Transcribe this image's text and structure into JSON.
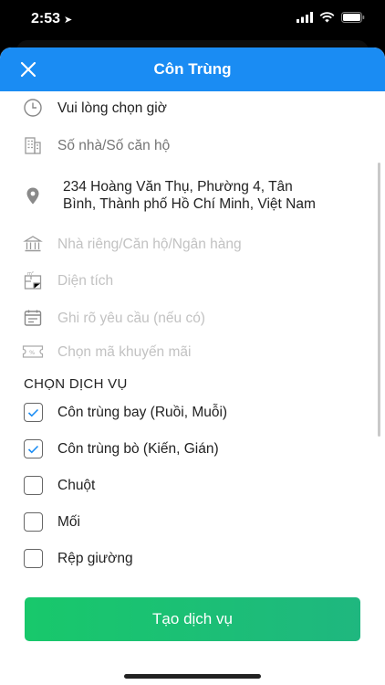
{
  "status_bar": {
    "time": "2:53",
    "location_icon": "location-arrow-icon",
    "wifi_icon": "wifi-icon",
    "battery_icon": "battery-icon"
  },
  "nav": {
    "title": "Côn Trùng",
    "close_icon": "close-icon"
  },
  "form": {
    "time_text": "Vui lòng chọn giờ",
    "house_number_placeholder": "Số nhà/Số căn hộ",
    "address_line1": "234 Hoàng Văn Thụ, Phường 4, Tân",
    "address_line2": "Bình, Thành phố Hồ Chí Minh, Việt Nam",
    "home_type_placeholder": "Nhà riêng/Căn hộ/Ngân hàng",
    "area_placeholder": "Diện tích",
    "note_placeholder": "Ghi rõ yêu cầu (nếu có)",
    "promo_placeholder": "Chọn mã khuyến mãi"
  },
  "services": {
    "title": "CHỌN DỊCH VỤ",
    "items": [
      {
        "label": "Côn trùng bay (Ruồi, Muỗi)",
        "checked": true
      },
      {
        "label": "Côn trùng bò (Kiến, Gián)",
        "checked": true
      },
      {
        "label": "Chuột",
        "checked": false
      },
      {
        "label": "Mối",
        "checked": false
      },
      {
        "label": "Rệp giường",
        "checked": false
      }
    ]
  },
  "submit_label": "Tạo dịch vụ",
  "colors": {
    "nav_blue": "#1a8cf3",
    "check_blue": "#1a8cf3",
    "button_green": "#18c86b",
    "placeholder_gray": "#c2c2c2"
  }
}
